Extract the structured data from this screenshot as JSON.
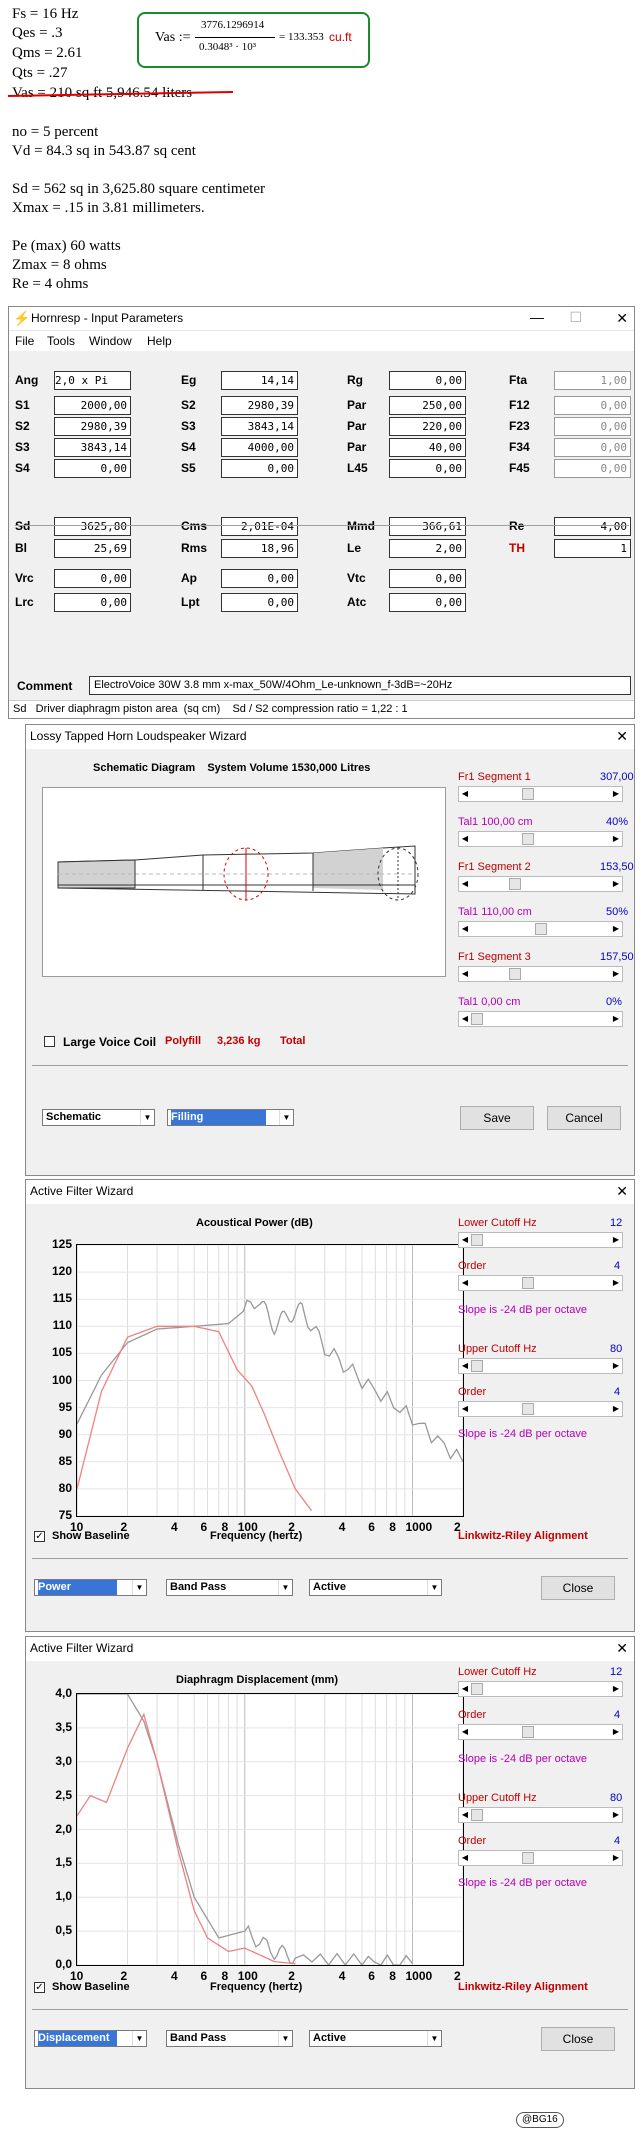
{
  "notes": {
    "fs": "Fs = 16 Hz",
    "qes": "Qes = .3",
    "qms": "Qms = 2.61",
    "qts": "Qts = .27",
    "vas_struck": "Vas = 210 sq ft 5,946.54 liters",
    "no": "no = 5 percent",
    "vd": "Vd = 84.3 sq in 543.87 sq cent",
    "sd": "Sd = 562 sq in 3,625.80 square centimeter",
    "xmax": "Xmax = .15 in 3.81 millimeters.",
    "pe": "Pe (max) 60 watts",
    "zmax": "Zmax = 8 ohms",
    "re": "Re = 4 ohms",
    "formula": {
      "lhs": "Vas :=",
      "numerator": "3776.1296914",
      "denominator": "0.3048³ · 10³",
      "rhs": "= 133.353",
      "unit": "cu.ft"
    }
  },
  "hornresp": {
    "title": "Hornresp - Input Parameters",
    "menu": [
      "File",
      "Tools",
      "Window",
      "Help"
    ],
    "params": [
      {
        "label": "Ang",
        "value": "2,0 x Pi"
      },
      {
        "label": "Eg",
        "value": "14,14"
      },
      {
        "label": "Rg",
        "value": "0,00"
      },
      {
        "label": "Fta",
        "value": "1,00"
      },
      {
        "label": "S1",
        "value": "2000,00"
      },
      {
        "label": "S2",
        "value": "2980,39"
      },
      {
        "label": "Par",
        "value": "250,00"
      },
      {
        "label": "F12",
        "value": "0,00"
      },
      {
        "label": "S2",
        "value": "2980,39"
      },
      {
        "label": "S3",
        "value": "3843,14"
      },
      {
        "label": "Par",
        "value": "220,00"
      },
      {
        "label": "F23",
        "value": "0,00"
      },
      {
        "label": "S3",
        "value": "3843,14"
      },
      {
        "label": "S4",
        "value": "4000,00"
      },
      {
        "label": "Par",
        "value": "40,00"
      },
      {
        "label": "F34",
        "value": "0,00"
      },
      {
        "label": "S4",
        "value": "0,00"
      },
      {
        "label": "S5",
        "value": "0,00"
      },
      {
        "label": "L45",
        "value": "0,00"
      },
      {
        "label": "F45",
        "value": "0,00"
      },
      {
        "label": "Sd",
        "value": "3625,80"
      },
      {
        "label": "Cms",
        "value": "2,01E-04"
      },
      {
        "label": "Mmd",
        "value": "366,61"
      },
      {
        "label": "Re",
        "value": "4,00"
      },
      {
        "label": "Bl",
        "value": "25,69"
      },
      {
        "label": "Rms",
        "value": "18,96"
      },
      {
        "label": "Le",
        "value": "2,00"
      },
      {
        "label": "TH",
        "value": "1"
      },
      {
        "label": "Vrc",
        "value": "0,00"
      },
      {
        "label": "Ap",
        "value": "0,00"
      },
      {
        "label": "Vtc",
        "value": "0,00"
      },
      {
        "label": "Lrc",
        "value": "0,00"
      },
      {
        "label": "Lpt",
        "value": "0,00"
      },
      {
        "label": "Atc",
        "value": "0,00"
      }
    ],
    "comment_label": "Comment",
    "comment": "ElectroVoice 30W 3.8 mm x-max_50W/4Ohm_Le-unknown_f-3dB=~20Hz",
    "status": "Sd   Driver diaphragm piston area  (sq cm)    Sd / S2 compression ratio = 1,22 : 1"
  },
  "wizard": {
    "title": "Lossy Tapped Horn Loudspeaker Wizard",
    "heading": "Schematic Diagram    System Volume 1530,000 Litres",
    "segments": [
      {
        "name": "Fr1  Segment 1",
        "value": "307,00",
        "tal": "Tal1  100,00 cm",
        "pct": "40%",
        "level": 0.4,
        "level2": 0.4
      },
      {
        "name": "Fr1  Segment 2",
        "value": "153,50",
        "tal": "Tal1  110,00 cm",
        "pct": "50%",
        "level": 0.3,
        "level2": 0.5
      },
      {
        "name": "Fr1  Segment 3",
        "value": "157,50",
        "tal": "Tal1  0,00 cm",
        "pct": "0%",
        "level": 0.3,
        "level2": 0.0
      }
    ],
    "voice_coil": "Large Voice Coil",
    "polyfill": "Polyfill",
    "kg": "3,236 kg",
    "total": "Total",
    "view_select": "Schematic",
    "fill_select": "Filling",
    "save": "Save",
    "cancel": "Cancel"
  },
  "filter_panel": {
    "lower": "Lower Cutoff  Hz",
    "lower_val": "12",
    "order": "Order",
    "order_val": "4",
    "slope": "Slope is -24 dB per octave",
    "upper": "Upper Cutoff  Hz",
    "upper_val": "80",
    "show_baseline": "Show Baseline",
    "freq_label": "Frequency (hertz)",
    "alignment": "Linkwitz-Riley Alignment",
    "band": "Band Pass",
    "active": "Active",
    "close": "Close"
  },
  "filter1": {
    "title": "Active Filter Wizard",
    "chart_title": "Acoustical Power (dB)",
    "mode": "Power"
  },
  "filter2": {
    "title": "Active Filter Wizard",
    "chart_title": "Diaphragm Displacement (mm)",
    "mode": "Displacement"
  },
  "chart_data": [
    {
      "type": "line",
      "title": "Acoustical Power (dB)",
      "xlabel": "Frequency (hertz)",
      "xscale": "log",
      "xlim": [
        10,
        20000
      ],
      "ylim": [
        75,
        125
      ],
      "x_ticks": [
        "10",
        "2",
        "4",
        "6",
        "8",
        "100",
        "2",
        "4",
        "6",
        "8",
        "1000",
        "2"
      ],
      "y_ticks": [
        "125",
        "120",
        "115",
        "110",
        "105",
        "100",
        "95",
        "90",
        "85",
        "80",
        "75"
      ],
      "series": [
        {
          "color": "#999999",
          "x": [
            10,
            14,
            20,
            30,
            50,
            80,
            120,
            150,
            180,
            220,
            300,
            500,
            1000,
            2000
          ],
          "y": [
            92,
            101,
            107,
            109.5,
            110,
            110.5,
            115,
            110,
            112,
            113,
            106,
            100,
            93,
            85
          ]
        },
        {
          "color": "#f08080",
          "x": [
            10,
            14,
            20,
            30,
            50,
            70,
            90,
            110,
            130,
            160,
            200,
            250
          ],
          "y": [
            80,
            98,
            108,
            110,
            110,
            109,
            102,
            99,
            94,
            87,
            80,
            76
          ]
        }
      ]
    },
    {
      "type": "line",
      "title": "Diaphragm Displacement (mm)",
      "xlabel": "Frequency (hertz)",
      "xscale": "log",
      "xlim": [
        10,
        20000
      ],
      "ylim": [
        0,
        4
      ],
      "x_ticks": [
        "10",
        "2",
        "4",
        "6",
        "8",
        "100",
        "2",
        "4",
        "6",
        "8",
        "1000",
        "2"
      ],
      "y_ticks": [
        "4,0",
        "3,5",
        "3,0",
        "2,5",
        "2,0",
        "1,5",
        "1,0",
        "0,5",
        "0,0"
      ],
      "series": [
        {
          "color": "#999999",
          "x": [
            10,
            15,
            20,
            25,
            30,
            40,
            50,
            70,
            100,
            150,
            200,
            500,
            1000
          ],
          "y": [
            4.0,
            4.2,
            4.0,
            3.6,
            3.0,
            1.8,
            1.0,
            0.4,
            0.5,
            0.2,
            0.12,
            0.04,
            0.02
          ]
        },
        {
          "color": "#f08080",
          "x": [
            10,
            12,
            15,
            20,
            25,
            30,
            40,
            50,
            60,
            80,
            100,
            150,
            200
          ],
          "y": [
            2.2,
            2.5,
            2.4,
            3.2,
            3.7,
            3.0,
            1.7,
            0.8,
            0.4,
            0.2,
            0.25,
            0.05,
            0.02
          ]
        }
      ]
    }
  ],
  "signature": "@BG16"
}
